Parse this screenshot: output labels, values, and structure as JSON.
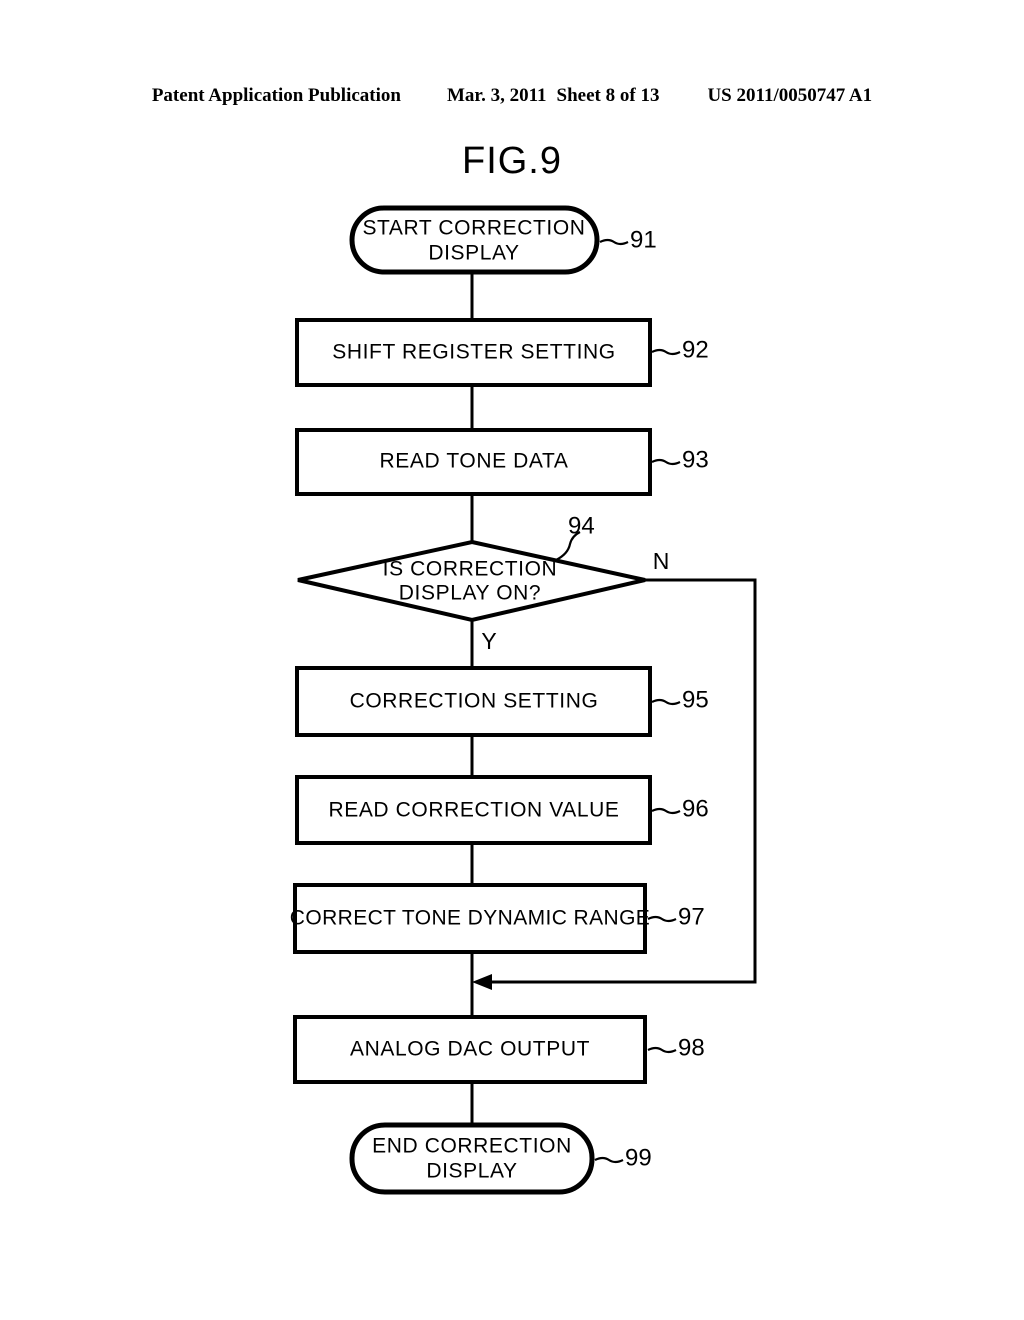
{
  "header": {
    "publication": "Patent Application Publication",
    "date": "Mar. 3, 2011",
    "sheet": "Sheet 8 of 13",
    "number": "US 2011/0050747 A1"
  },
  "figure": {
    "title": "FIG.9"
  },
  "flowchart": {
    "nodes": [
      {
        "id": "start",
        "type": "terminator",
        "lines": [
          "START CORRECTION",
          "DISPLAY"
        ],
        "ref": "91"
      },
      {
        "id": "shift-register-setting",
        "type": "process",
        "lines": [
          "SHIFT REGISTER SETTING"
        ],
        "ref": "92"
      },
      {
        "id": "read-tone-data",
        "type": "process",
        "lines": [
          "READ TONE DATA"
        ],
        "ref": "93"
      },
      {
        "id": "is-correction-display-on",
        "type": "decision",
        "lines": [
          "IS CORRECTION",
          "DISPLAY ON?"
        ],
        "ref": "94"
      },
      {
        "id": "correction-setting",
        "type": "process",
        "lines": [
          "CORRECTION SETTING"
        ],
        "ref": "95"
      },
      {
        "id": "read-correction-value",
        "type": "process",
        "lines": [
          "READ CORRECTION VALUE"
        ],
        "ref": "96"
      },
      {
        "id": "correct-tone-dynamic-range",
        "type": "process",
        "lines": [
          "CORRECT TONE DYNAMIC RANGE"
        ],
        "ref": "97"
      },
      {
        "id": "analog-dac-output",
        "type": "process",
        "lines": [
          "ANALOG DAC OUTPUT"
        ],
        "ref": "98"
      },
      {
        "id": "end",
        "type": "terminator",
        "lines": [
          "END CORRECTION",
          "DISPLAY"
        ],
        "ref": "99"
      }
    ],
    "branch_labels": {
      "yes": "Y",
      "no": "N"
    },
    "ref_prefix": "~"
  },
  "colors": {
    "ink": "#000000",
    "paper": "#ffffff"
  }
}
